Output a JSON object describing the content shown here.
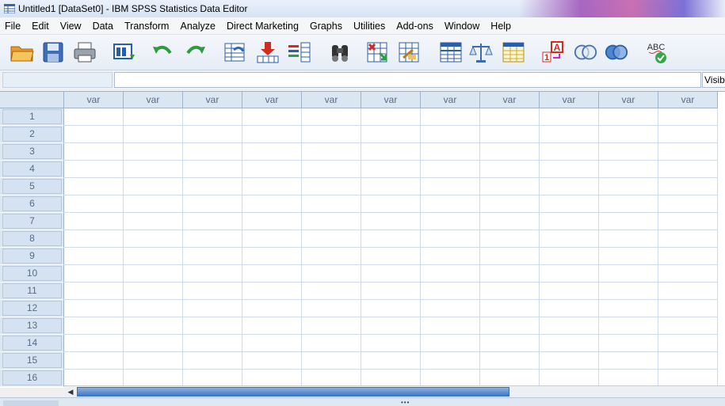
{
  "window": {
    "title": "Untitled1 [DataSet0] - IBM SPSS Statistics Data Editor"
  },
  "menu": {
    "file": "File",
    "edit": "Edit",
    "view": "View",
    "data": "Data",
    "transform": "Transform",
    "analyze": "Analyze",
    "direct_marketing": "Direct Marketing",
    "graphs": "Graphs",
    "utilities": "Utilities",
    "addons": "Add-ons",
    "window": "Window",
    "help": "Help"
  },
  "toolbar": {
    "icons": [
      "open-folder-icon",
      "save-icon",
      "print-icon",
      "recall-dialog-icon",
      "undo-icon",
      "redo-icon",
      "go-to-case-icon",
      "go-to-variable-icon",
      "variables-icon",
      "find-icon",
      "insert-cases-icon",
      "insert-variable-icon",
      "split-file-icon",
      "weight-cases-icon",
      "select-cases-icon",
      "value-labels-icon",
      "use-variable-sets-icon",
      "show-all-variables-icon",
      "spell-check-icon"
    ],
    "value_labels_glyph": "A",
    "value_labels_number": "1",
    "spell_glyph": "ABC"
  },
  "cellbar": {
    "cell_name": "",
    "cell_value": "",
    "visible_label": "Visible"
  },
  "grid": {
    "columns": [
      "var",
      "var",
      "var",
      "var",
      "var",
      "var",
      "var",
      "var",
      "var",
      "var",
      "var"
    ],
    "rows": [
      "1",
      "2",
      "3",
      "4",
      "5",
      "6",
      "7",
      "8",
      "9",
      "10",
      "11",
      "12",
      "13",
      "14",
      "15",
      "16"
    ]
  },
  "colors": {
    "header_bg": "#dbe6f3",
    "grid_line": "#cfdbe8",
    "scroll_thumb": "#3f78c5"
  }
}
